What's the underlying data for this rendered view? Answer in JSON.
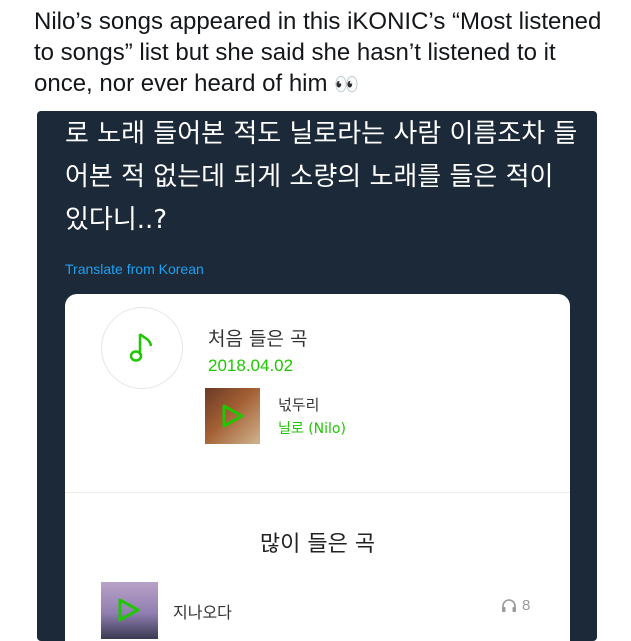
{
  "tweet": {
    "caption": "Nilo’s songs appeared in this iKONIC’s “Most listened to songs” list but she said she hasn’t listened to it once, nor ever heard of him",
    "caption_emoji": "👀",
    "korean_text": "로 노래 들어본 적도 닐로라는 사람 이름조차 들어본 적 없는데 되게 소량의 노래를 들은 적이 있다니..?",
    "translate_link": "Translate from Korean"
  },
  "screenshot": {
    "first_listen_label": "처음 들은 곡",
    "first_listen_date": "2018.04.02",
    "first_track": {
      "title": "넋두리",
      "artist": "닐로 (Nilo)"
    },
    "most_listened_label": "많이 들은 곡",
    "top_track": {
      "title": "지나오다",
      "plays": "8"
    }
  },
  "colors": {
    "card_bg": "#1c2939",
    "link_blue": "#1da1f2",
    "accent_green": "#1ec800"
  },
  "icons": [
    "music-note-icon",
    "play-icon",
    "headphones-icon",
    "eyes-emoji"
  ]
}
